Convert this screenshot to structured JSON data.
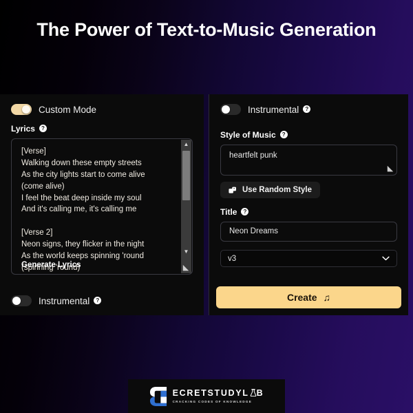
{
  "title": "The Power of Text-to-Music Generation",
  "colors": {
    "accent": "#fbd68b",
    "toggle_on": "#f2d8a5",
    "panel_bg": "#0b0b0b",
    "bg_start": "#000000",
    "bg_end": "#2a0f66"
  },
  "left_panel": {
    "custom_mode": {
      "label": "Custom Mode",
      "state": "on",
      "icon": "toggle-icon"
    },
    "lyrics_label": "Lyrics",
    "lyrics_help_icon": "help-icon",
    "lyrics_value": "[Verse]\nWalking down these empty streets\nAs the city lights start to come alive\n(come alive)\nI feel the beat deep inside my soul\nAnd it's calling me, it's calling me\n\n[Verse 2]\nNeon signs, they flicker in the night\nAs the world keeps spinning 'round\n(spinning 'round)",
    "generate_lyrics_label": "Generate Lyrics",
    "scrollbar": {
      "up_arrow": "▲",
      "down_arrow": "▼"
    },
    "resize_grip_icon": "resize-grip-icon",
    "instrumental": {
      "label": "Instrumental",
      "state": "off",
      "icon": "toggle-icon",
      "help_icon": "help-icon"
    }
  },
  "right_panel": {
    "instrumental": {
      "label": "Instrumental",
      "state": "off",
      "icon": "toggle-icon",
      "help_icon": "help-icon"
    },
    "style_label": "Style of Music",
    "style_help_icon": "help-icon",
    "style_value": "heartfelt punk",
    "random_style_label": "Use Random Style",
    "random_style_icon": "dice-icon",
    "title_label": "Title",
    "title_help_icon": "help-icon",
    "title_value": "Neon Dreams",
    "version_value": "v3",
    "version_chevron_icon": "chevron-down-icon",
    "create_label": "Create",
    "create_icon": "music-note-icon",
    "create_note_glyph": "♫"
  },
  "footer": {
    "logo_mark_icon": "secretstudylab-s-icon",
    "brand_prefix": "ECRETSTUDYL",
    "brand_flask_icon": "flask-icon",
    "brand_suffix": "B",
    "tagline": "CRACKING CODES OF KNOWLEDGE"
  }
}
